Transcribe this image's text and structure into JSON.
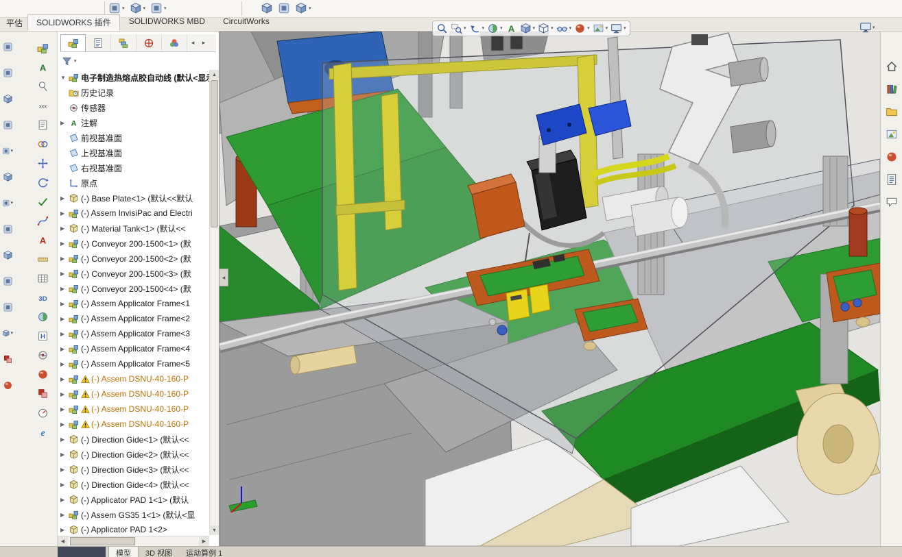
{
  "ribbon": {
    "corner_tab": "平估",
    "tabs": [
      {
        "name": "tab-solidworks-addins",
        "label": "SOLIDWORKS 插件",
        "active": true
      },
      {
        "name": "tab-solidworks-mbd",
        "label": "SOLIDWORKS MBD",
        "active": false
      },
      {
        "name": "tab-circuitworks",
        "label": "CircuitWorks",
        "active": false
      }
    ]
  },
  "topbar": {
    "group_a": [
      {
        "name": "menu-tool-1-icon",
        "icon_ref": "#sym-tool",
        "caret": true
      },
      {
        "name": "menu-tool-2-icon",
        "icon_ref": "#sym-cube",
        "caret": true
      },
      {
        "name": "menu-tool-3-icon",
        "icon_ref": "#sym-tool",
        "caret": true
      }
    ],
    "group_b": [
      {
        "name": "menu-tool-4-icon",
        "icon_ref": "#sym-cube",
        "caret": false
      },
      {
        "name": "menu-tool-5-icon",
        "icon_ref": "#sym-tool",
        "caret": false
      },
      {
        "name": "menu-tool-6-icon",
        "icon_ref": "#sym-cube",
        "caret": true
      }
    ]
  },
  "tree": {
    "tabs": [
      {
        "name": "featuremanager-tab",
        "icon_ref": "#sym-assembly",
        "active": true
      },
      {
        "name": "propertymanager-tab",
        "icon_ref": "#sym-props",
        "active": false
      },
      {
        "name": "configurationmanager-tab",
        "icon_ref": "#sym-config",
        "active": false
      },
      {
        "name": "dimxpertmanager-tab",
        "icon_ref": "#sym-dimx",
        "active": false
      },
      {
        "name": "displaymanager-tab",
        "icon_ref": "#sym-colorwheel",
        "active": false
      }
    ],
    "tab_scroll_left": "◂",
    "tab_scroll_right": "▸",
    "root": {
      "arrow": "▼",
      "label": "电子制造热熔点胶自动线 (默认<显示"
    },
    "items": [
      {
        "a": "",
        "icon_ref": "#sym-history",
        "label": "历史记录"
      },
      {
        "a": "",
        "icon_ref": "#sym-sensor",
        "label": "传感器"
      },
      {
        "a": "▶",
        "icon_ref": "#sym-annot",
        "label": "注解"
      },
      {
        "a": "",
        "icon_ref": "#sym-plane",
        "label": "前视基准面"
      },
      {
        "a": "",
        "icon_ref": "#sym-plane",
        "label": "上视基准面"
      },
      {
        "a": "",
        "icon_ref": "#sym-plane",
        "label": "右视基准面"
      },
      {
        "a": "",
        "icon_ref": "#sym-origin",
        "label": "原点"
      },
      {
        "a": "▶",
        "icon_ref": "#sym-part",
        "label": "(-) Base Plate<1> (默认<<默认"
      },
      {
        "a": "▶",
        "icon_ref": "#sym-assembly",
        "label": "(-) Assem InvisiPac and Electri"
      },
      {
        "a": "▶",
        "icon_ref": "#sym-part",
        "label": "(-) Material Tank<1> (默认<<"
      },
      {
        "a": "▶",
        "icon_ref": "#sym-assembly",
        "label": "(-) Conveyor 200-1500<1> (默"
      },
      {
        "a": "▶",
        "icon_ref": "#sym-assembly",
        "label": "(-) Conveyor 200-1500<2> (默"
      },
      {
        "a": "▶",
        "icon_ref": "#sym-assembly",
        "label": "(-) Conveyor 200-1500<3> (默"
      },
      {
        "a": "▶",
        "icon_ref": "#sym-assembly",
        "label": "(-) Conveyor 200-1500<4> (默"
      },
      {
        "a": "▶",
        "icon_ref": "#sym-assembly",
        "label": "(-) Assem Applicator Frame<1"
      },
      {
        "a": "▶",
        "icon_ref": "#sym-assembly",
        "label": "(-) Assem Applicator Frame<2"
      },
      {
        "a": "▶",
        "icon_ref": "#sym-assembly",
        "label": "(-) Assem Applicator Frame<3"
      },
      {
        "a": "▶",
        "icon_ref": "#sym-assembly",
        "label": "(-) Assem Applicator Frame<4"
      },
      {
        "a": "▶",
        "icon_ref": "#sym-assembly",
        "label": "(-) Assem Applicator Frame<5"
      },
      {
        "a": "▶",
        "icon_ref": "#sym-assembly",
        "w": true,
        "o": true,
        "label": "(-) Assem DSNU-40-160-P"
      },
      {
        "a": "▶",
        "icon_ref": "#sym-assembly",
        "w": true,
        "o": true,
        "label": "(-) Assem DSNU-40-160-P"
      },
      {
        "a": "▶",
        "icon_ref": "#sym-assembly",
        "w": true,
        "o": true,
        "label": "(-) Assem DSNU-40-160-P"
      },
      {
        "a": "▶",
        "icon_ref": "#sym-assembly",
        "w": true,
        "o": true,
        "label": "(-) Assem DSNU-40-160-P"
      },
      {
        "a": "▶",
        "icon_ref": "#sym-part",
        "label": "(-) Direction Gide<1> (默认<<"
      },
      {
        "a": "▶",
        "icon_ref": "#sym-part",
        "label": "(-) Direction Gide<2> (默认<<"
      },
      {
        "a": "▶",
        "icon_ref": "#sym-part",
        "label": "(-) Direction Gide<3> (默认<<"
      },
      {
        "a": "▶",
        "icon_ref": "#sym-part",
        "label": "(-) Direction Gide<4> (默认<<"
      },
      {
        "a": "▶",
        "icon_ref": "#sym-part",
        "label": "(-) Applicator PAD 1<1> (默认"
      },
      {
        "a": "▶",
        "icon_ref": "#sym-assembly",
        "label": "(-) Assem GS35 1<1> (默认<显"
      },
      {
        "a": "▶",
        "icon_ref": "#sym-part",
        "label": "(-) Applicator PAD 1<2>"
      }
    ]
  },
  "left_toolbar": {
    "icons": [
      {
        "name": "exploded-view-icon",
        "icon_ref": "#sym-assembly"
      },
      {
        "name": "annotation-icon",
        "icon_ref": "#sym-aletter"
      },
      {
        "name": "balloon-icon",
        "icon_ref": "#sym-balloon"
      },
      {
        "name": "weld-symbol-icon",
        "icon_ref": "#sym-xxx"
      },
      {
        "name": "note-icon",
        "icon_ref": "#sym-note"
      },
      {
        "name": "mate-icon",
        "icon_ref": "#sym-mate"
      },
      {
        "name": "move-component-icon",
        "icon_ref": "#sym-move"
      },
      {
        "name": "rotate-component-icon",
        "icon_ref": "#sym-rotate"
      },
      {
        "name": "equation-check-icon",
        "icon_ref": "#sym-check"
      },
      {
        "name": "spline-icon",
        "icon_ref": "#sym-spline"
      },
      {
        "name": "text-format-icon",
        "icon_ref": "#sym-ared"
      },
      {
        "name": "measure-icon",
        "icon_ref": "#sym-ruler"
      },
      {
        "name": "bom-table-icon",
        "icon_ref": "#sym-table"
      },
      {
        "name": "3d-drawing-view-icon",
        "icon_ref": "#sym-threed"
      },
      {
        "name": "section-view-tool-icon",
        "icon_ref": "#sym-cutview"
      },
      {
        "name": "hole-wizard-icon",
        "icon_ref": "#sym-hletter"
      },
      {
        "name": "sensor-tool-icon",
        "icon_ref": "#sym-sensor"
      },
      {
        "name": "edit-appearance-tool-icon",
        "icon_ref": "#sym-sphere"
      },
      {
        "name": "interference-detection-icon",
        "icon_ref": "#sym-interfere"
      },
      {
        "name": "performance-evaluation-icon",
        "icon_ref": "#sym-gauge"
      },
      {
        "name": "internet-explorer-icon",
        "icon_ref": "#sym-eletter"
      }
    ]
  },
  "edge_toolbar": {
    "icons": [
      {
        "name": "edge-tool-1-icon",
        "icon_ref": "#sym-tool"
      },
      {
        "name": "edge-tool-2-icon",
        "icon_ref": "#sym-tool"
      },
      {
        "name": "edge-tool-3-icon",
        "icon_ref": "#sym-cube"
      },
      {
        "name": "edge-tool-4-icon",
        "icon_ref": "#sym-tool"
      },
      {
        "name": "edge-tool-5-icon",
        "icon_ref": "#sym-tool",
        "caret": true
      },
      {
        "name": "edge-tool-6-icon",
        "icon_ref": "#sym-cube"
      },
      {
        "name": "edge-tool-7-icon",
        "icon_ref": "#sym-tool",
        "caret": true
      },
      {
        "name": "edge-tool-8-icon",
        "icon_ref": "#sym-tool"
      },
      {
        "name": "edge-tool-9-icon",
        "icon_ref": "#sym-cube"
      },
      {
        "name": "edge-tool-10-icon",
        "icon_ref": "#sym-tool"
      },
      {
        "name": "edge-tool-11-icon",
        "icon_ref": "#sym-tool"
      },
      {
        "name": "edge-tool-12-icon",
        "icon_ref": "#sym-cube",
        "caret": true
      },
      {
        "name": "edge-tool-13-icon",
        "icon_ref": "#sym-interfere"
      },
      {
        "name": "edge-tool-14-icon",
        "icon_ref": "#sym-sphere"
      }
    ]
  },
  "headsup": {
    "icons": [
      {
        "name": "zoom-fit-icon",
        "icon_ref": "#sym-zoomfit"
      },
      {
        "name": "zoom-area-icon",
        "icon_ref": "#sym-zoomarea",
        "caret": true
      },
      {
        "name": "previous-view-icon",
        "icon_ref": "#sym-prevview",
        "caret": true
      },
      {
        "name": "section-view-icon",
        "icon_ref": "#sym-cutview",
        "caret": true
      },
      {
        "name": "dynamic-annotation-icon",
        "icon_ref": "#sym-aletter"
      },
      {
        "name": "view-orientation-icon",
        "icon_ref": "#sym-cube",
        "caret": true
      },
      {
        "name": "display-style-icon",
        "icon_ref": "#sym-wirecube",
        "caret": true
      },
      {
        "name": "hide-show-items-icon",
        "icon_ref": "#sym-hideshow",
        "caret": true
      },
      {
        "name": "edit-appearance-icon",
        "icon_ref": "#sym-sphere",
        "caret": true
      },
      {
        "name": "apply-scene-icon",
        "icon_ref": "#sym-scene",
        "caret": true
      },
      {
        "name": "view-settings-icon",
        "icon_ref": "#sym-monitor",
        "caret": true
      }
    ]
  },
  "task_pane": {
    "icons": [
      {
        "name": "home-icon",
        "icon_ref": "#sym-home"
      },
      {
        "name": "design-library-icon",
        "icon_ref": "#sym-library"
      },
      {
        "name": "file-explorer-icon",
        "icon_ref": "#sym-folder"
      },
      {
        "name": "view-palette-icon",
        "icon_ref": "#sym-palette"
      },
      {
        "name": "appearances-icon",
        "icon_ref": "#sym-sphere"
      },
      {
        "name": "custom-properties-icon",
        "icon_ref": "#sym-props"
      },
      {
        "name": "forum-icon",
        "icon_ref": "#sym-chat"
      }
    ]
  },
  "statusbar": {
    "tabs": [
      {
        "name": "model-tab",
        "label": "模型",
        "active": true
      },
      {
        "name": "3d-views-tab",
        "label": "3D 视图",
        "active": false
      },
      {
        "name": "motion-study-tab",
        "label": "运动算例 1",
        "active": false
      }
    ]
  },
  "colors": {
    "accent_blue": "#2E63B5",
    "machine_green": "#2E9C33",
    "frame_yellow": "#E2D50A",
    "part_orange": "#C2591C",
    "roller_tan": "#E9D8AC",
    "warning_text": "#C07000"
  }
}
